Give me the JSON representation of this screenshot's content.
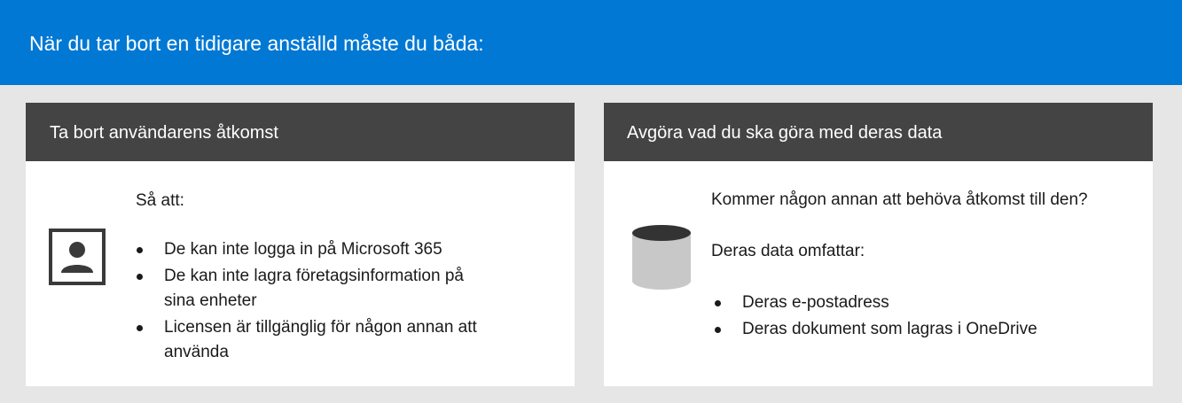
{
  "banner": {
    "title": "När du tar bort en tidigare anställd måste du båda:"
  },
  "left_card": {
    "title": "Ta bort användarens åtkomst",
    "lead": "Så att:",
    "icon": "user-icon",
    "bullets": [
      "De kan inte logga in på Microsoft 365",
      "De kan inte lagra företagsinformation på sina enheter",
      "Licensen är tillgänglig för någon annan att använda"
    ]
  },
  "right_card": {
    "title": "Avgöra vad du ska göra med deras data",
    "question": "Kommer någon annan att behöva åtkomst till den?",
    "lead": "Deras data omfattar:",
    "icon": "database-icon",
    "bullets": [
      "Deras e-postadress",
      "Deras dokument som lagras i OneDrive"
    ]
  },
  "colors": {
    "banner": "#0078d4",
    "card_header": "#444444",
    "frame": "#e6e6e6",
    "database_top": "#333333",
    "database_body": "#c8c8c8"
  }
}
